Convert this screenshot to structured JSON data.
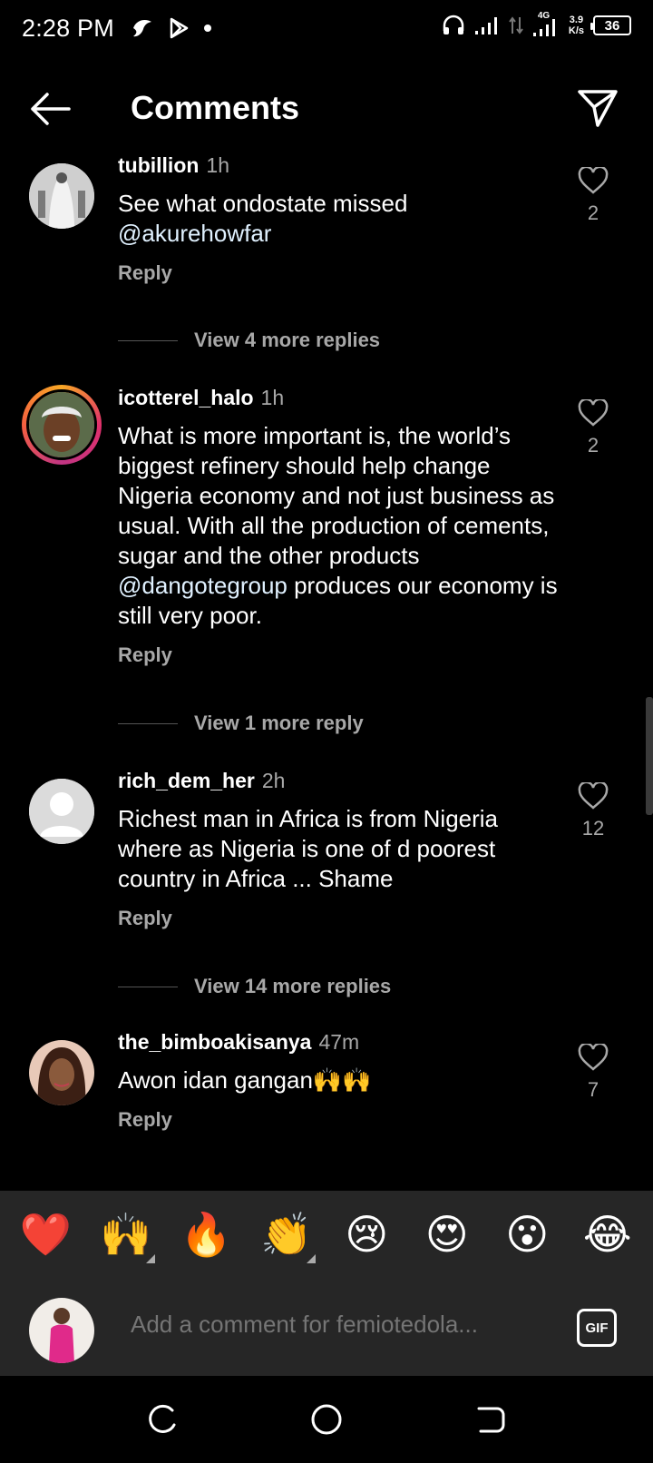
{
  "status": {
    "time": "2:28 PM",
    "network_type": "4G",
    "net_speed_value": "3.9",
    "net_speed_unit": "K/s",
    "battery": "36"
  },
  "header": {
    "title": "Comments",
    "back_icon": "arrow-left-icon",
    "share_icon": "send-icon"
  },
  "comments": [
    {
      "username": "tubillion",
      "time": "1h",
      "text_plain": "See what ondostate missed ",
      "mention": "@akurehowfar",
      "text_after": "",
      "reply_label": "Reply",
      "likes": "2",
      "view_more": "View 4 more replies"
    },
    {
      "username": "icotterel_halo",
      "time": "1h",
      "text_plain": "What is more important is, the world’s biggest refinery should help change Nigeria economy and not just business as usual. With all the production of cements, sugar and the other products ",
      "mention": "@dangotegroup",
      "text_after": " produces our economy is still very poor.",
      "reply_label": "Reply",
      "likes": "2",
      "view_more": "View 1 more reply"
    },
    {
      "username": "rich_dem_her",
      "time": "2h",
      "text_plain": "Richest man in Africa is from Nigeria where as Nigeria is one of d poorest country in Africa ... Shame",
      "mention": "",
      "text_after": "",
      "reply_label": "Reply",
      "likes": "12",
      "view_more": "View 14 more replies"
    },
    {
      "username": "the_bimboakisanya",
      "time": "47m",
      "text_plain": "Awon idan gangan🙌🙌",
      "mention": "",
      "text_after": "",
      "reply_label": "Reply",
      "likes": "7",
      "view_more": ""
    }
  ],
  "emoji_bar": [
    "❤️",
    "🙌",
    "🔥",
    "👏",
    "😢",
    "😍",
    "😮",
    "😂"
  ],
  "composer": {
    "placeholder": "Add a comment for femiotedola...",
    "gif_label": "GIF"
  },
  "colors": {
    "background": "#000000",
    "secondary_text": "#a8a8a8",
    "panel": "#262626",
    "mention": "#e0f1ff"
  }
}
